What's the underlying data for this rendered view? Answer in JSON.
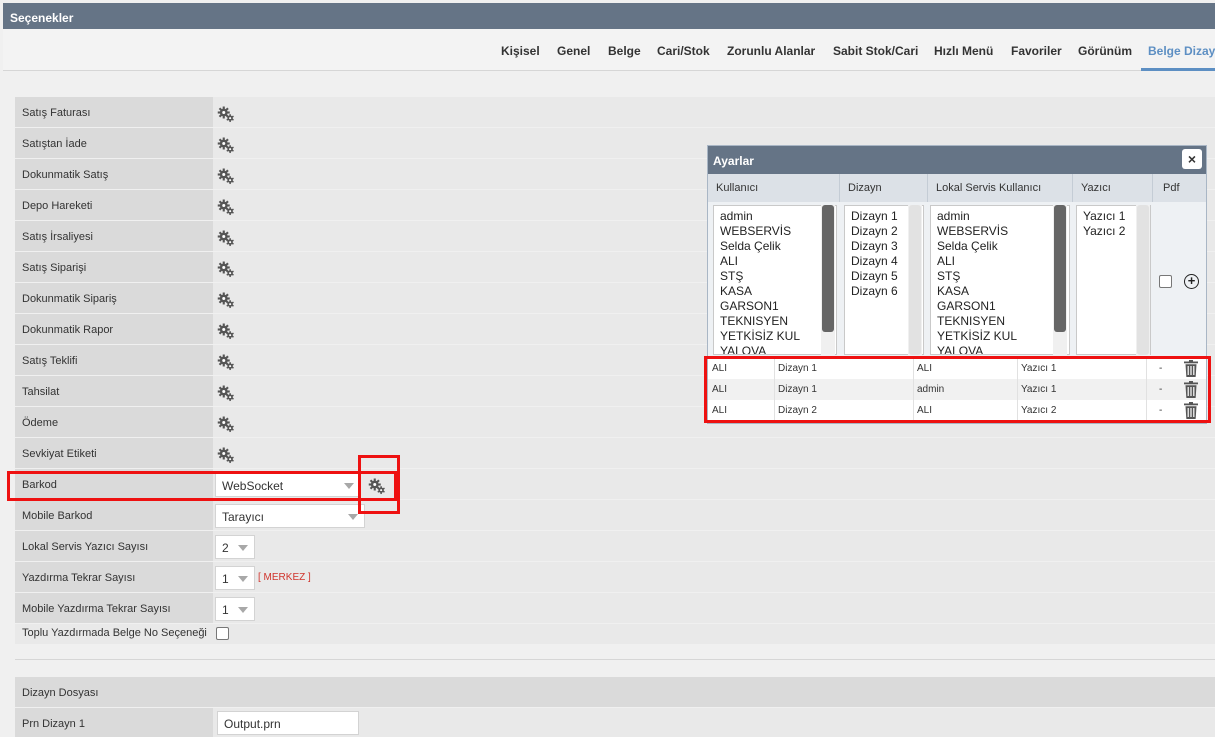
{
  "window": {
    "title": "Seçenekler"
  },
  "tabs": [
    {
      "label": "Kişisel"
    },
    {
      "label": "Genel"
    },
    {
      "label": "Belge"
    },
    {
      "label": "Cari/Stok"
    },
    {
      "label": "Zorunlu Alanlar"
    },
    {
      "label": "Sabit Stok/Cari"
    },
    {
      "label": "Hızlı Menü"
    },
    {
      "label": "Favoriler"
    },
    {
      "label": "Görünüm"
    },
    {
      "label": "Belge Dizayn"
    }
  ],
  "active_tab": "Belge Dizayn",
  "form": {
    "gear_rows": [
      {
        "label": "Satış Faturası"
      },
      {
        "label": "Satıştan İade"
      },
      {
        "label": "Dokunmatik Satış"
      },
      {
        "label": "Depo Hareketi"
      },
      {
        "label": "Satış İrsaliyesi"
      },
      {
        "label": "Satış Siparişi"
      },
      {
        "label": "Dokunmatik Sipariş"
      },
      {
        "label": "Dokunmatik Rapor"
      },
      {
        "label": "Satış Teklifi"
      },
      {
        "label": "Tahsilat"
      },
      {
        "label": "Ödeme"
      },
      {
        "label": "Sevkiyat Etiketi"
      }
    ],
    "barkod": {
      "label": "Barkod",
      "value": "WebSocket"
    },
    "mobile_barkod": {
      "label": "Mobile Barkod",
      "value": "Tarayıcı"
    },
    "lokal_servis_yazici_sayisi": {
      "label": "Lokal Servis Yazıcı Sayısı",
      "value": "2"
    },
    "yazdirma_tekrar_sayisi": {
      "label": "Yazdırma Tekrar Sayısı",
      "value": "1",
      "note": "[ MERKEZ ]"
    },
    "mobile_yazdirma_tekrar_sayisi": {
      "label": "Mobile Yazdırma Tekrar Sayısı",
      "value": "1"
    },
    "toplu_yazdirma": {
      "label": "Toplu Yazdırmada Belge No Seçeneği",
      "checked": false
    },
    "dizayn_dosyasi": {
      "label": "Dizayn Dosyası"
    },
    "prn_dizayn_1": {
      "label": "Prn Dizayn 1",
      "value": "Output.prn"
    }
  },
  "dialog": {
    "title": "Ayarlar",
    "close_label": "×",
    "columns": [
      "Kullanıcı",
      "Dizayn",
      "Lokal Servis Kullanıcı",
      "Yazıcı",
      "Pdf"
    ],
    "kullanici_list": [
      "admin",
      "WEBSERVİS",
      "Selda Çelik",
      "ALI",
      "STŞ",
      "KASA",
      "GARSON1",
      "TEKNISYEN",
      "YETKİSİZ KUL",
      "YALOVA"
    ],
    "dizayn_list": [
      "Dizayn 1",
      "Dizayn 2",
      "Dizayn 3",
      "Dizayn 4",
      "Dizayn 5",
      "Dizayn 6"
    ],
    "lokal_list": [
      "admin",
      "WEBSERVİS",
      "Selda Çelik",
      "ALI",
      "STŞ",
      "KASA",
      "GARSON1",
      "TEKNISYEN",
      "YETKİSİZ KUL",
      "YALOVA"
    ],
    "yazici_list": [
      "Yazıcı 1",
      "Yazıcı 2"
    ],
    "pdf_checked": false,
    "add_label": "+",
    "rows": [
      {
        "kullanici": "ALI",
        "dizayn": "Dizayn 1",
        "lokal": "ALI",
        "yazici": "Yazıcı 1",
        "pdf": "-"
      },
      {
        "kullanici": "ALI",
        "dizayn": "Dizayn 1",
        "lokal": "admin",
        "yazici": "Yazıcı 1",
        "pdf": "-"
      },
      {
        "kullanici": "ALI",
        "dizayn": "Dizayn 2",
        "lokal": "ALI",
        "yazici": "Yazıcı 2",
        "pdf": "-"
      }
    ]
  }
}
